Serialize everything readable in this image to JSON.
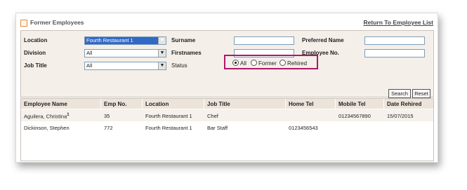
{
  "window": {
    "title": "Former Employees",
    "return_link": "Return To Employee List"
  },
  "search": {
    "location_label": "Location",
    "location_value": "Fourth Restaurant 1",
    "division_label": "Division",
    "division_value": "All",
    "job_title_label": "Job Title",
    "job_title_value": "All",
    "surname_label": "Surname",
    "firstnames_label": "Firstnames",
    "status_label": "Status",
    "preferred_name_label": "Preferred Name",
    "employee_no_label": "Employee No.",
    "status_options": [
      {
        "label": "All",
        "selected": true
      },
      {
        "label": "Former",
        "selected": false
      },
      {
        "label": "Rehired",
        "selected": false
      }
    ],
    "search_button": "Search",
    "reset_button": "Reset"
  },
  "table": {
    "columns": [
      "Employee Name",
      "Emp No.",
      "Location",
      "Job Title",
      "Home Tel",
      "Mobile Tel",
      "Date Rehired"
    ],
    "rows": [
      {
        "name": "Aguilera, Christina",
        "marker": "1",
        "emp_no": "35",
        "location": "Fourth Restaurant 1",
        "job_title": "Chef",
        "home_tel": "",
        "mobile_tel": "01234567890",
        "date_rehired": "15/07/2015"
      },
      {
        "name": "Dickinson, Stephen",
        "marker": "",
        "emp_no": "772",
        "location": "Fourth Restaurant 1",
        "job_title": "Bar Staff",
        "home_tel": "0123456543",
        "mobile_tel": "",
        "date_rehired": ""
      }
    ]
  },
  "colors": {
    "highlight_border": "#b0166a",
    "panel_bg": "#f4efe9",
    "header_bg": "#ece4da",
    "selected_bg": "#3169c6"
  }
}
